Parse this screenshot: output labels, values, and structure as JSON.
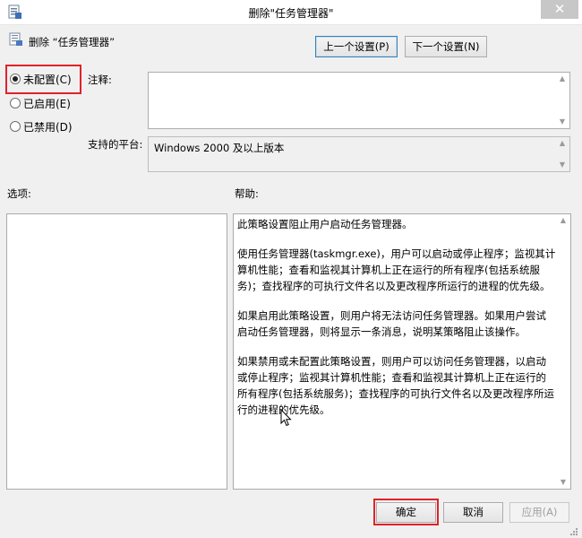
{
  "window": {
    "title": "删除\"任务管理器\"",
    "close_glyph": "✕"
  },
  "header": {
    "policy_title": "删除 “任务管理器”",
    "prev_label": "上一个设置(P)",
    "next_label": "下一个设置(N)"
  },
  "state_options": [
    {
      "label": "未配置(C)",
      "checked": true
    },
    {
      "label": "已启用(E)",
      "checked": false
    },
    {
      "label": "已禁用(D)",
      "checked": false
    }
  ],
  "comment": {
    "label": "注释:",
    "value": ""
  },
  "platform": {
    "label": "支持的平台:",
    "value": "Windows 2000 及以上版本"
  },
  "options": {
    "label": "选项:"
  },
  "help": {
    "label": "帮助:",
    "paragraphs": [
      "此策略设置阻止用户启动任务管理器。",
      "使用任务管理器(taskmgr.exe)，用户可以启动或停止程序；监视其计算机性能；查看和监视其计算机上正在运行的所有程序(包括系统服务)；查找程序的可执行文件名以及更改程序所运行的进程的优先级。",
      "如果启用此策略设置，则用户将无法访问任务管理器。如果用户尝试启动任务管理器，则将显示一条消息，说明某策略阻止该操作。",
      "如果禁用或未配置此策略设置，则用户可以访问任务管理器，以启动或停止程序；监视其计算机性能；查看和监视其计算机上正在运行的所有程序(包括系统服务)；查找程序的可执行文件名以及更改程序所运行的进程的优先级。"
    ]
  },
  "footer": {
    "ok_label": "确定",
    "cancel_label": "取消",
    "apply_label": "应用(A)"
  },
  "colors": {
    "highlight": "#e0222a",
    "accent_border": "#3c7fb1"
  },
  "icons": [
    "policy-icon",
    "gpo-app-icon",
    "close-icon",
    "mouse-cursor-icon"
  ]
}
